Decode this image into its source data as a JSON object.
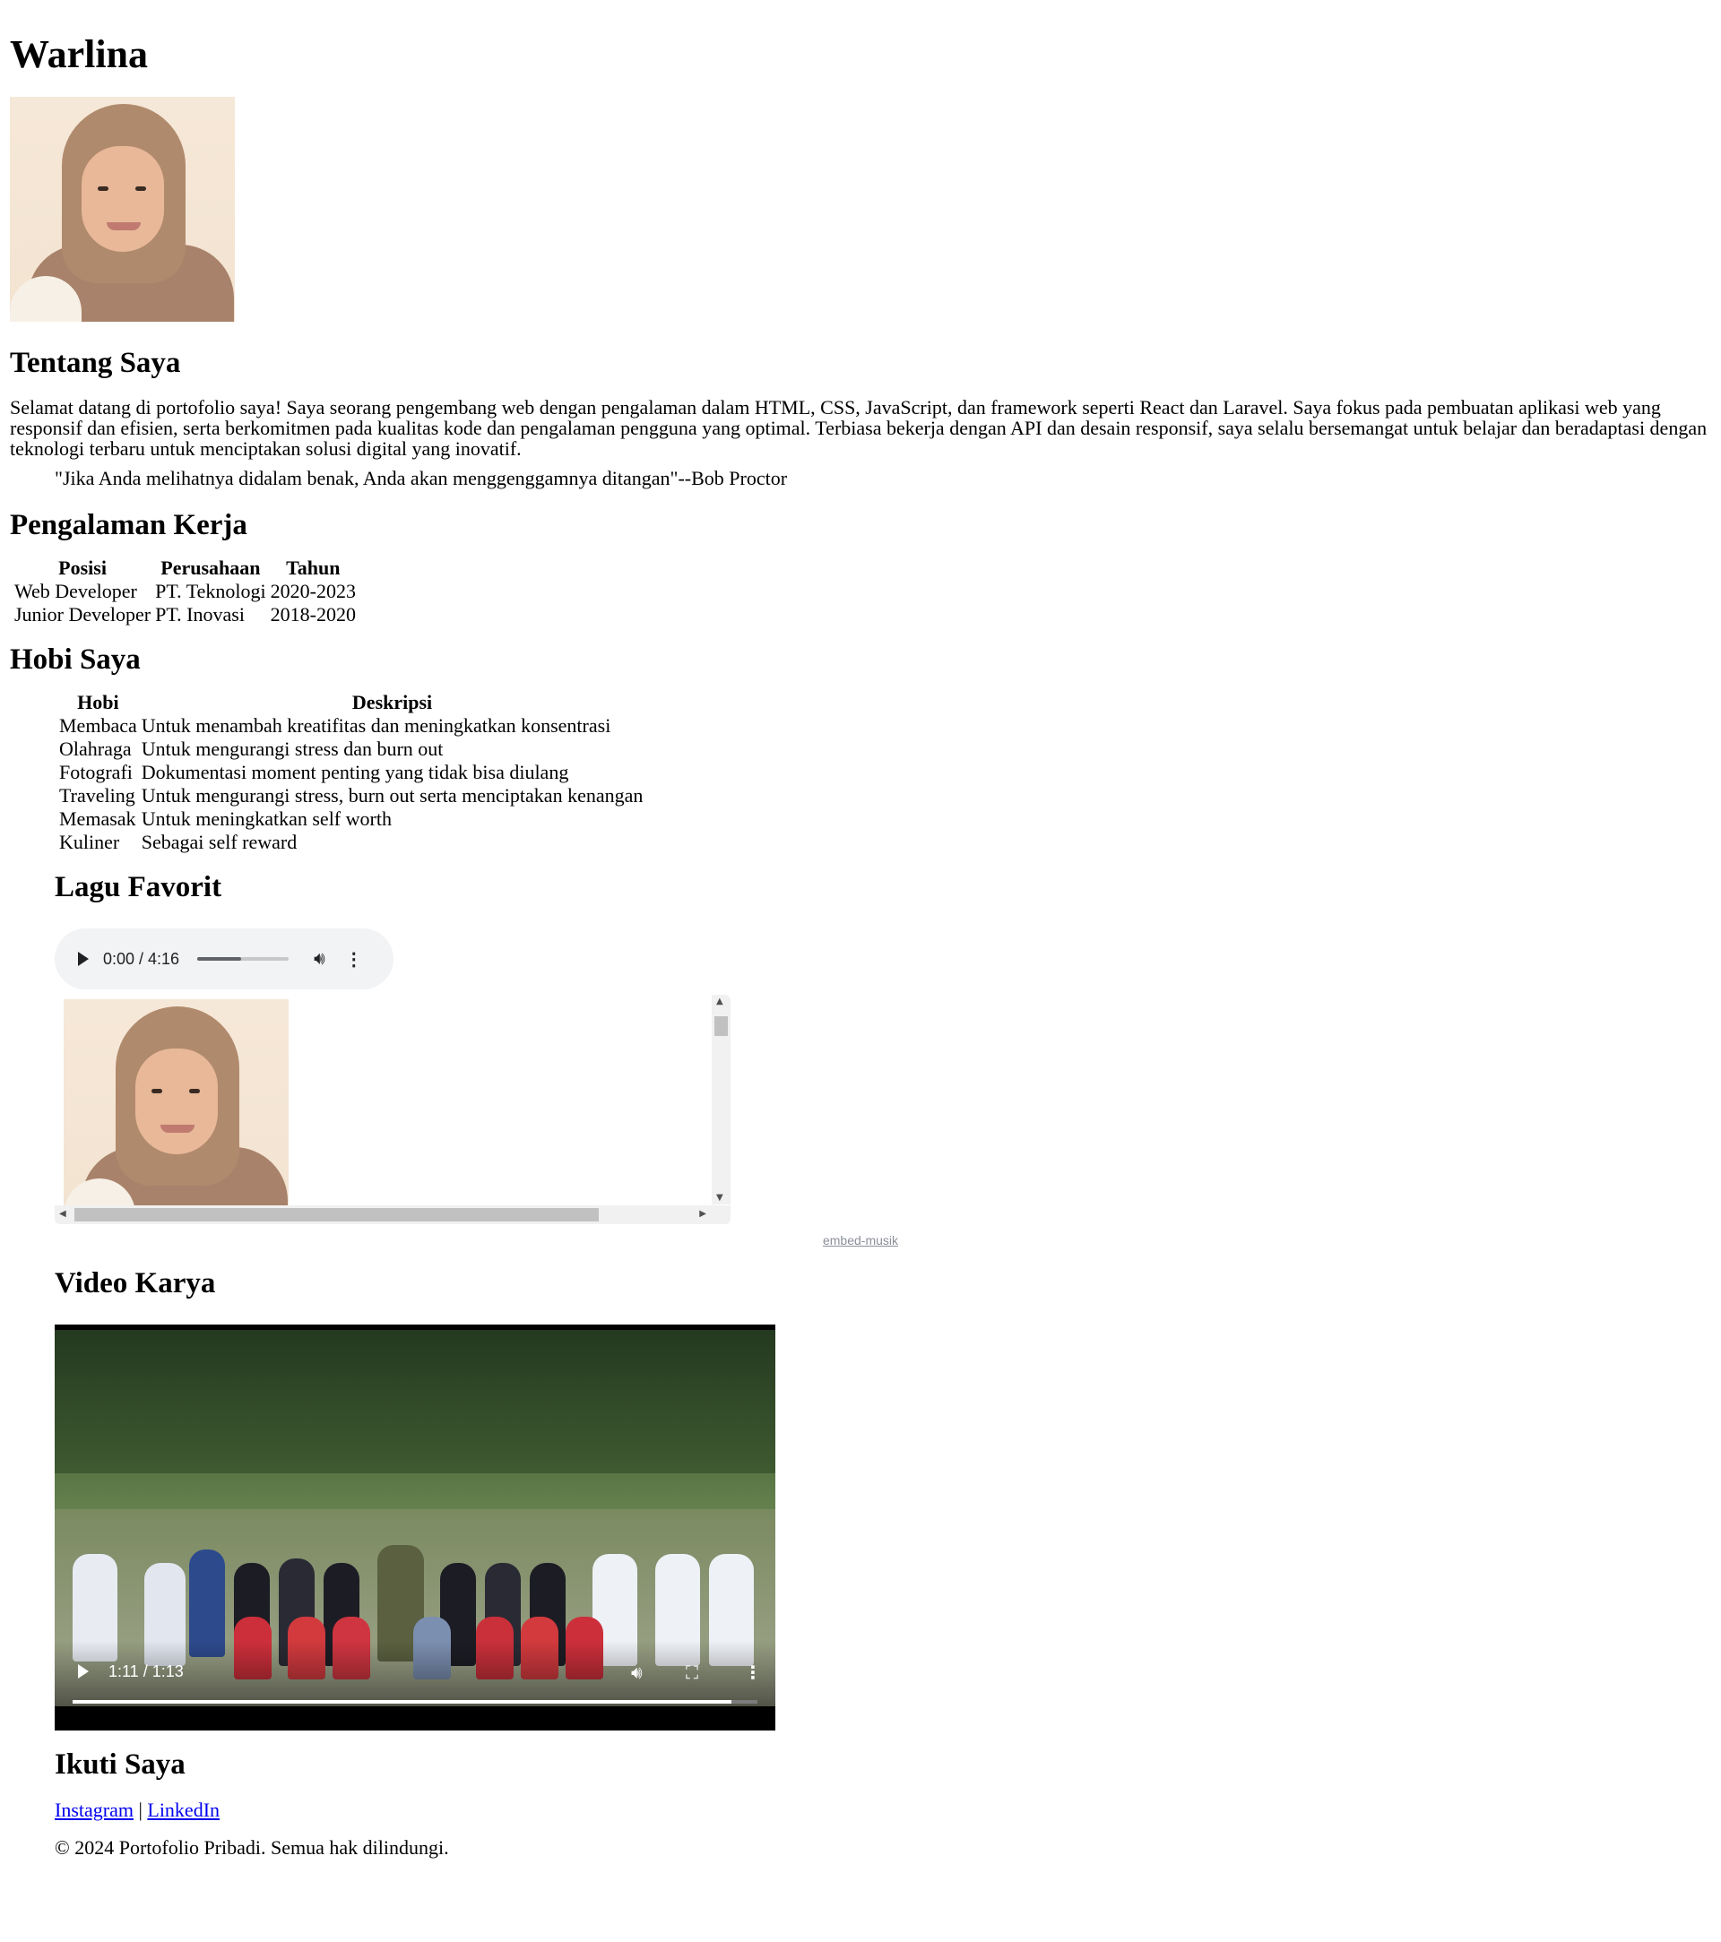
{
  "header": {
    "name": "Warlina"
  },
  "about": {
    "heading": "Tentang Saya",
    "text": "Selamat datang di portofolio saya! Saya seorang pengembang web dengan pengalaman dalam HTML, CSS, JavaScript, dan framework seperti React dan Laravel. Saya fokus pada pembuatan aplikasi web yang responsif dan efisien, serta berkomitmen pada kualitas kode dan pengalaman pengguna yang optimal. Terbiasa bekerja dengan API dan desain responsif, saya selalu bersemangat untuk belajar dan beradaptasi dengan teknologi terbaru untuk menciptakan solusi digital yang inovatif.",
    "quote": "\"Jika Anda melihatnya didalam benak, Anda akan menggenggamnya ditangan\"--Bob Proctor"
  },
  "experience": {
    "heading": "Pengalaman Kerja",
    "columns": [
      "Posisi",
      "Perusahaan",
      "Tahun"
    ],
    "rows": [
      [
        "Web Developer",
        "PT. Teknologi",
        "2020-2023"
      ],
      [
        "Junior Developer",
        "PT. Inovasi",
        "2018-2020"
      ]
    ]
  },
  "hobbies": {
    "heading": "Hobi Saya",
    "columns": [
      "Hobi",
      "Deskripsi"
    ],
    "rows": [
      [
        "Membaca",
        "Untuk menambah kreatifitas dan meningkatkan konsentrasi"
      ],
      [
        "Olahraga",
        "Untuk mengurangi stress dan burn out"
      ],
      [
        "Fotografi",
        "Dokumentasi moment penting yang tidak bisa diulang"
      ],
      [
        "Traveling",
        "Untuk mengurangi stress, burn out serta menciptakan kenangan"
      ],
      [
        "Memasak",
        "Untuk meningkatkan self worth"
      ],
      [
        "Kuliner",
        "Sebagai self reward"
      ]
    ]
  },
  "music": {
    "heading": "Lagu Favorit",
    "audio_time": "0:00 / 4:16",
    "volume_level": 0.48,
    "embed_link": "embed-musik"
  },
  "video": {
    "heading": "Video Karya",
    "time": "1:11 / 1:13",
    "progress": 0.962
  },
  "social": {
    "heading": "Ikuti Saya",
    "instagram": "Instagram",
    "separator": "|",
    "linkedin": "LinkedIn"
  },
  "footer": {
    "text": "© 2024 Portofolio Pribadi. Semua hak dilindungi."
  },
  "icons": {
    "play": "play-icon",
    "volume": "volume-icon",
    "more": "more-vert-icon",
    "fullscreen": "fullscreen-icon"
  }
}
